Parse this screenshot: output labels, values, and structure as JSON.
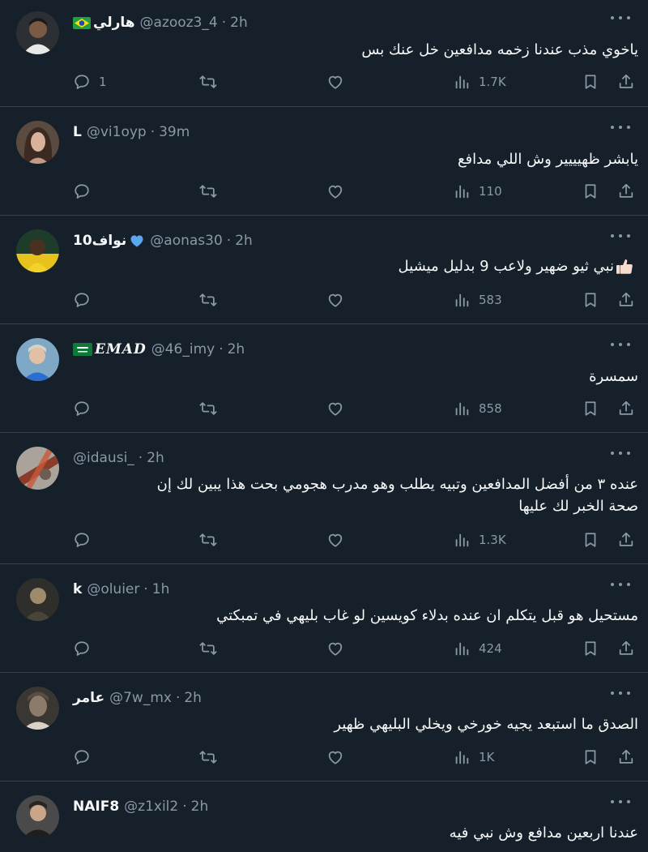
{
  "colors": {
    "background": "#15202b",
    "text": "#f7f9f9",
    "muted": "#8b98a5",
    "divider": "#38444d"
  },
  "tweets": [
    {
      "name": "هارلي",
      "name_decoration": "brazil-flag",
      "handle": "@azooz3_4",
      "dot": "·",
      "time": "2h",
      "lines": [
        "ياخوي مذب عندنا زخمه مدافعين خل عنك بس"
      ],
      "replies": "1",
      "retweets": "",
      "likes": "",
      "views": "1.7K"
    },
    {
      "name": "L",
      "handle": "@vi1oyp",
      "dot": "·",
      "time": "39m",
      "lines": [
        "يابشر ظهيييير وش اللي مدافع"
      ],
      "replies": "",
      "retweets": "",
      "likes": "",
      "views": "110"
    },
    {
      "name": "نواف10",
      "name_decoration": "blue-heart",
      "handle": "@aonas30",
      "dot": "·",
      "time": "2h",
      "lines": [
        "نبي ثيو ضهير ولاعب 9 بدليل ميشيل"
      ],
      "replies": "",
      "retweets": "",
      "likes": "",
      "views": "583"
    },
    {
      "name": "EMAD",
      "name_decoration": "saudi-flag",
      "handle": "@46_imy",
      "dot": "·",
      "time": "2h",
      "lines": [
        "سمسرة"
      ],
      "replies": "",
      "retweets": "",
      "likes": "",
      "views": "858"
    },
    {
      "name": "",
      "handle": "@idausi_",
      "dot": "·",
      "time": "2h",
      "lines": [
        "عنده ٣ من أفضل المدافعين وتبيه يطلب وهو مدرب هجومي بحت هذا يبين لك إن",
        "صحة الخبر لك عليها"
      ],
      "replies": "",
      "retweets": "",
      "likes": "",
      "views": "1.3K"
    },
    {
      "name": "k",
      "handle": "@oluier",
      "dot": "·",
      "time": "1h",
      "lines": [
        "مستحيل هو قبل يتكلم ان عنده بدلاء كويسين لو غاب بليهي في تمبكتي"
      ],
      "replies": "",
      "retweets": "",
      "likes": "",
      "views": "424"
    },
    {
      "name": "عامر",
      "handle": "@7w_mx",
      "dot": "·",
      "time": "2h",
      "lines": [
        "الصدق ما استبعد يجيه خورخي ويخلي البليهي ظهير"
      ],
      "replies": "",
      "retweets": "",
      "likes": "",
      "views": "1K"
    },
    {
      "name": "NAIF8",
      "handle": "@z1xil2",
      "dot": "·",
      "time": "2h",
      "lines": [
        "عندنا اربعين مدافع وش نبي فيه"
      ],
      "replies": "",
      "retweets": "",
      "likes": "",
      "views": ""
    }
  ]
}
